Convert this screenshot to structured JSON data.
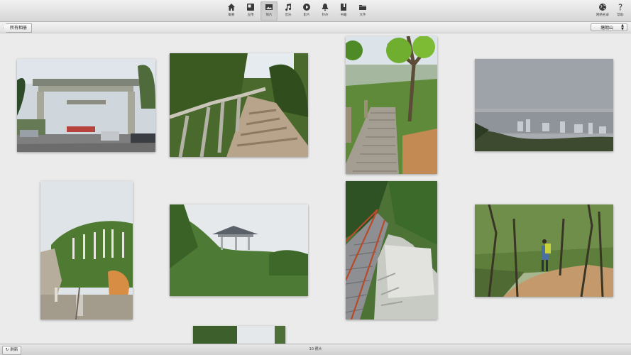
{
  "toolbar": {
    "items": [
      {
        "label": "概要",
        "icon": "home-icon"
      },
      {
        "label": "应用",
        "icon": "apps-icon"
      },
      {
        "label": "照片",
        "icon": "photos-icon"
      },
      {
        "label": "音乐",
        "icon": "music-icon"
      },
      {
        "label": "影片",
        "icon": "play-icon"
      },
      {
        "label": "铃声",
        "icon": "bell-icon"
      },
      {
        "label": "书籍",
        "icon": "book-icon"
      },
      {
        "label": "文件",
        "icon": "folder-icon"
      }
    ],
    "active": "照片",
    "right": [
      {
        "label": "网络名录",
        "icon": "globe-icon"
      },
      {
        "label": "帮助",
        "icon": "help-icon"
      }
    ]
  },
  "subbar": {
    "back_label": "所有相册",
    "album_select": "塘朗山"
  },
  "photos": [
    {
      "name": "photo-gate"
    },
    {
      "name": "photo-stone-steps-railing"
    },
    {
      "name": "photo-tree-stairs"
    },
    {
      "name": "photo-city-haze"
    },
    {
      "name": "photo-rock-garden"
    },
    {
      "name": "photo-pavilion"
    },
    {
      "name": "photo-red-railing-stairs"
    },
    {
      "name": "photo-forest-hiker"
    },
    {
      "name": "photo-partial"
    }
  ],
  "footer": {
    "refresh_label": "刷新",
    "count_text": "10 照片"
  },
  "colors": {
    "toolbar_bg": "#e2e2e2",
    "content_bg": "#ebebeb"
  }
}
